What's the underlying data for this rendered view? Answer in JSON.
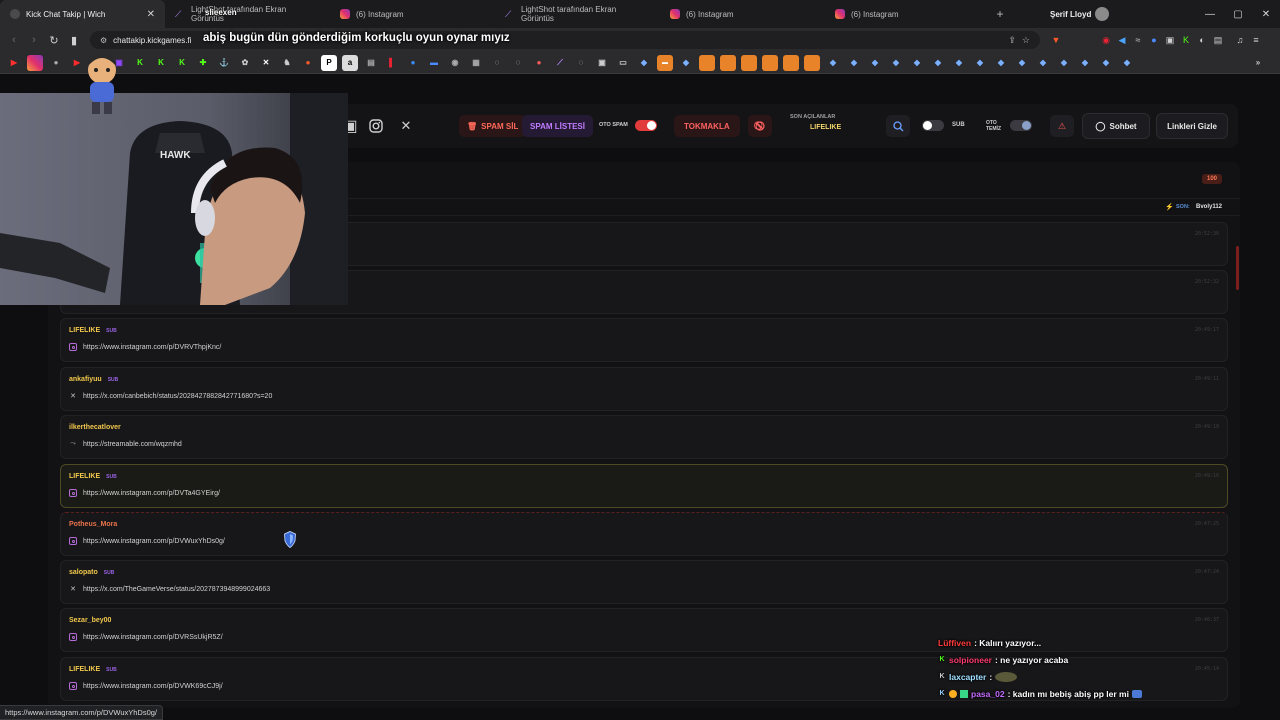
{
  "browser": {
    "tabs": [
      {
        "label": "Kick Chat Takip | Wich",
        "active": true
      },
      {
        "label": "LightShot tarafından Ekran Görüntüs"
      },
      {
        "label": "(6) Instagram"
      },
      {
        "label": "LightShot tarafından Ekran Görüntüs"
      },
      {
        "label": "(6) Instagram"
      },
      {
        "label": "(6) Instagram"
      }
    ],
    "profile_name": "Şerif Lloyd",
    "url": "chattakip.kickgames.fi",
    "status_url": "https://www.instagram.com/p/DVWuxYhDs0g/"
  },
  "overlay": {
    "title": "abiş bugün dün gönderdiğim korkuçlu oyun oynar mıyız",
    "username": "slieexen",
    "chat": [
      {
        "user": "Lüffiven",
        "text": ": Kalıırı yazıyor...",
        "color": "#ff3b3b"
      },
      {
        "user": "solpioneer",
        "text": ": ne yazıyor acaba",
        "color": "#ff3b6e"
      },
      {
        "user": "laxcapter",
        "text": ":",
        "color": "#9fe0ff"
      },
      {
        "user": "pasa_02",
        "text": ": kadın mı bebiş abiş pp ler mi",
        "color": "#c46bff"
      }
    ]
  },
  "toolbar": {
    "spam_sil": "SPAM SİL",
    "spam_listesi": "SPAM LİSTESİ",
    "oto_spam": "OTO SPAM",
    "tokmakla": "TOKMAKLA",
    "son_acilanlar_label": "SON AÇILANLAR",
    "son_acilanlar_value": "LIFELIKE",
    "sub_label": "SUB",
    "oto_temiz_line1": "OTO",
    "oto_temiz_line2": "TEMİZ",
    "sohbet": "Sohbet",
    "linkleri_gizle": "Linkleri Gizle"
  },
  "panel": {
    "count": "100",
    "son_label": "SON:",
    "son_user": "Bvoly112"
  },
  "messages": [
    {
      "user": "",
      "link": "",
      "time": "20:52:30",
      "source": "",
      "color": "#e8a04a"
    },
    {
      "user": "",
      "link": "",
      "time": "20:52:32",
      "source": "",
      "color": "#e8a04a"
    },
    {
      "user": "LIFELIKE",
      "sub": "SUB",
      "link": "https://www.instagram.com/p/DVRVThpjKnc/",
      "time": "20:49:17",
      "source": "instagram",
      "color": "#f2c84b"
    },
    {
      "user": "ankafiyuu",
      "sub": "SUB",
      "link": "https://x.com/canbebich/status/2028427882842771680?s=20",
      "time": "20:49:11",
      "source": "x",
      "color": "#f2c84b"
    },
    {
      "user": "ilkerthecatlover",
      "link": "https://streamable.com/wqzmhd",
      "time": "20:49:10",
      "source": "streamable",
      "color": "#f2c84b"
    },
    {
      "user": "LIFELIKE",
      "sub": "SUB",
      "link": "https://www.instagram.com/p/DVTa4GYEirg/",
      "time": "20:49:16",
      "source": "instagram",
      "color": "#f2c84b"
    },
    {
      "user": "Potheus_Mora",
      "link": "https://www.instagram.com/p/DVWuxYhDs0g/",
      "time": "20:47:25",
      "source": "instagram",
      "color": "#e8734a"
    },
    {
      "user": "salopato",
      "sub": "SUB",
      "link": "https://x.com/TheGameVerse/status/2027873948999024663",
      "time": "20:47:24",
      "source": "x",
      "color": "#f2c84b"
    },
    {
      "user": "Sezar_bey00",
      "link": "https://www.instagram.com/p/DVRSsUkjR5Z/",
      "time": "20:46:37",
      "source": "instagram",
      "color": "#f2c84b"
    },
    {
      "user": "LIFELIKE",
      "sub": "SUB",
      "link": "https://www.instagram.com/p/DVWK69cCJ9j/",
      "time": "20:45:14",
      "source": "instagram",
      "color": "#f2c84b"
    }
  ],
  "colors": {
    "accent_red": "#ff6060",
    "accent_purple": "#c07cff",
    "kick_green": "#53fc18",
    "username_gold": "#f2c84b"
  }
}
